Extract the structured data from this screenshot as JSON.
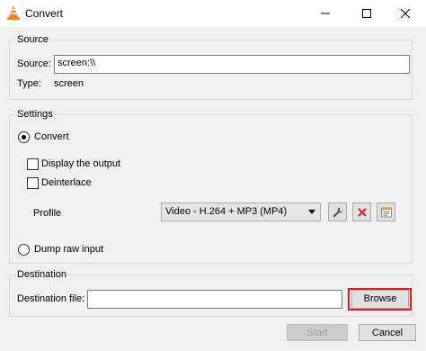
{
  "window": {
    "title": "Convert"
  },
  "source": {
    "group_title": "Source",
    "source_label": "Source:",
    "source_value": "screen:\\\\",
    "type_label": "Type:",
    "type_value": "screen"
  },
  "settings": {
    "group_title": "Settings",
    "convert_label": "Convert",
    "convert_selected": true,
    "display_output_label": "Display the output",
    "display_output_checked": false,
    "deinterlace_label": "Deinterlace",
    "deinterlace_checked": false,
    "profile_label": "Profile",
    "profile_selected": "Video - H.264 + MP3 (MP4)",
    "dump_raw_label": "Dump raw input",
    "dump_raw_selected": false
  },
  "destination": {
    "group_title": "Destination",
    "file_label": "Destination file:",
    "file_value": "",
    "browse_label": "Browse"
  },
  "footer": {
    "start_label": "Start",
    "cancel_label": "Cancel"
  },
  "colors": {
    "highlight": "#e21a1a",
    "delete_red": "#d62a2a"
  },
  "icons": [
    "vlc-cone-icon",
    "minimize-icon",
    "maximize-icon",
    "close-icon",
    "wrench-icon",
    "delete-icon",
    "new-profile-icon",
    "chevron-down-icon"
  ]
}
